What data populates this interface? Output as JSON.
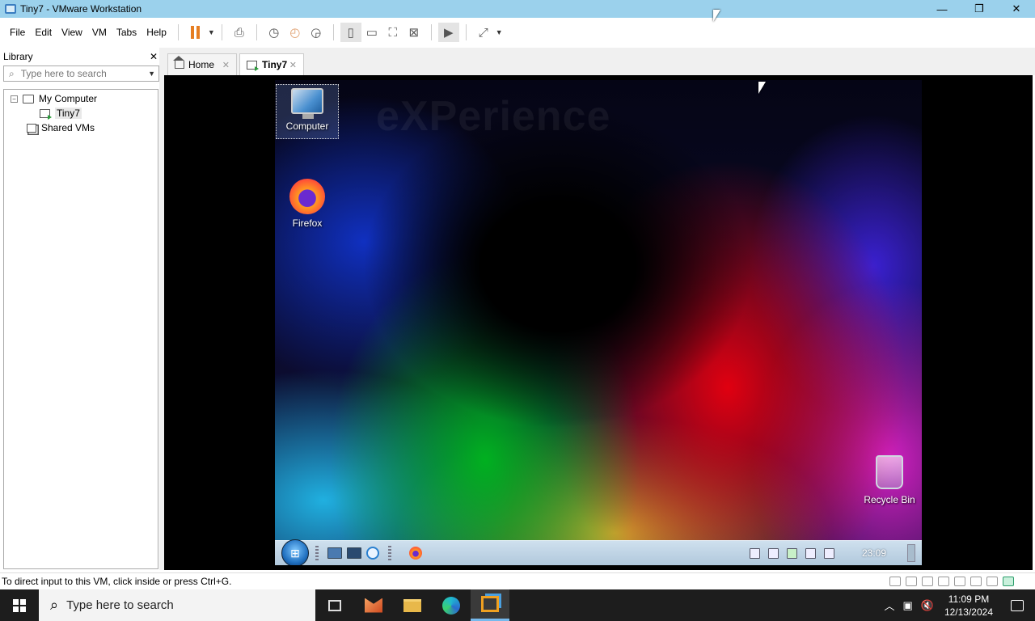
{
  "window": {
    "title": "Tiny7 - VMware Workstation",
    "minimize_glyph": "—",
    "restore_glyph": "❐",
    "close_glyph": "✕"
  },
  "menu": [
    "File",
    "Edit",
    "View",
    "VM",
    "Tabs",
    "Help"
  ],
  "library": {
    "title": "Library",
    "close_glyph": "✕",
    "search_placeholder": "Type here to search",
    "tree": {
      "root": "My Computer",
      "vm": "Tiny7",
      "shared": "Shared VMs"
    }
  },
  "tabs": {
    "home": "Home",
    "active": "Tiny7",
    "close_glyph": "✕"
  },
  "guest": {
    "watermark": "eXPerience",
    "icons": {
      "computer": "Computer",
      "firefox": "Firefox",
      "recycle_bin": "Recycle Bin"
    },
    "clock": "23:09"
  },
  "status": {
    "message": "To direct input to this VM, click inside or press Ctrl+G."
  },
  "host_taskbar": {
    "search_placeholder": "Type here to search",
    "time": "11:09 PM",
    "date": "12/13/2024"
  }
}
